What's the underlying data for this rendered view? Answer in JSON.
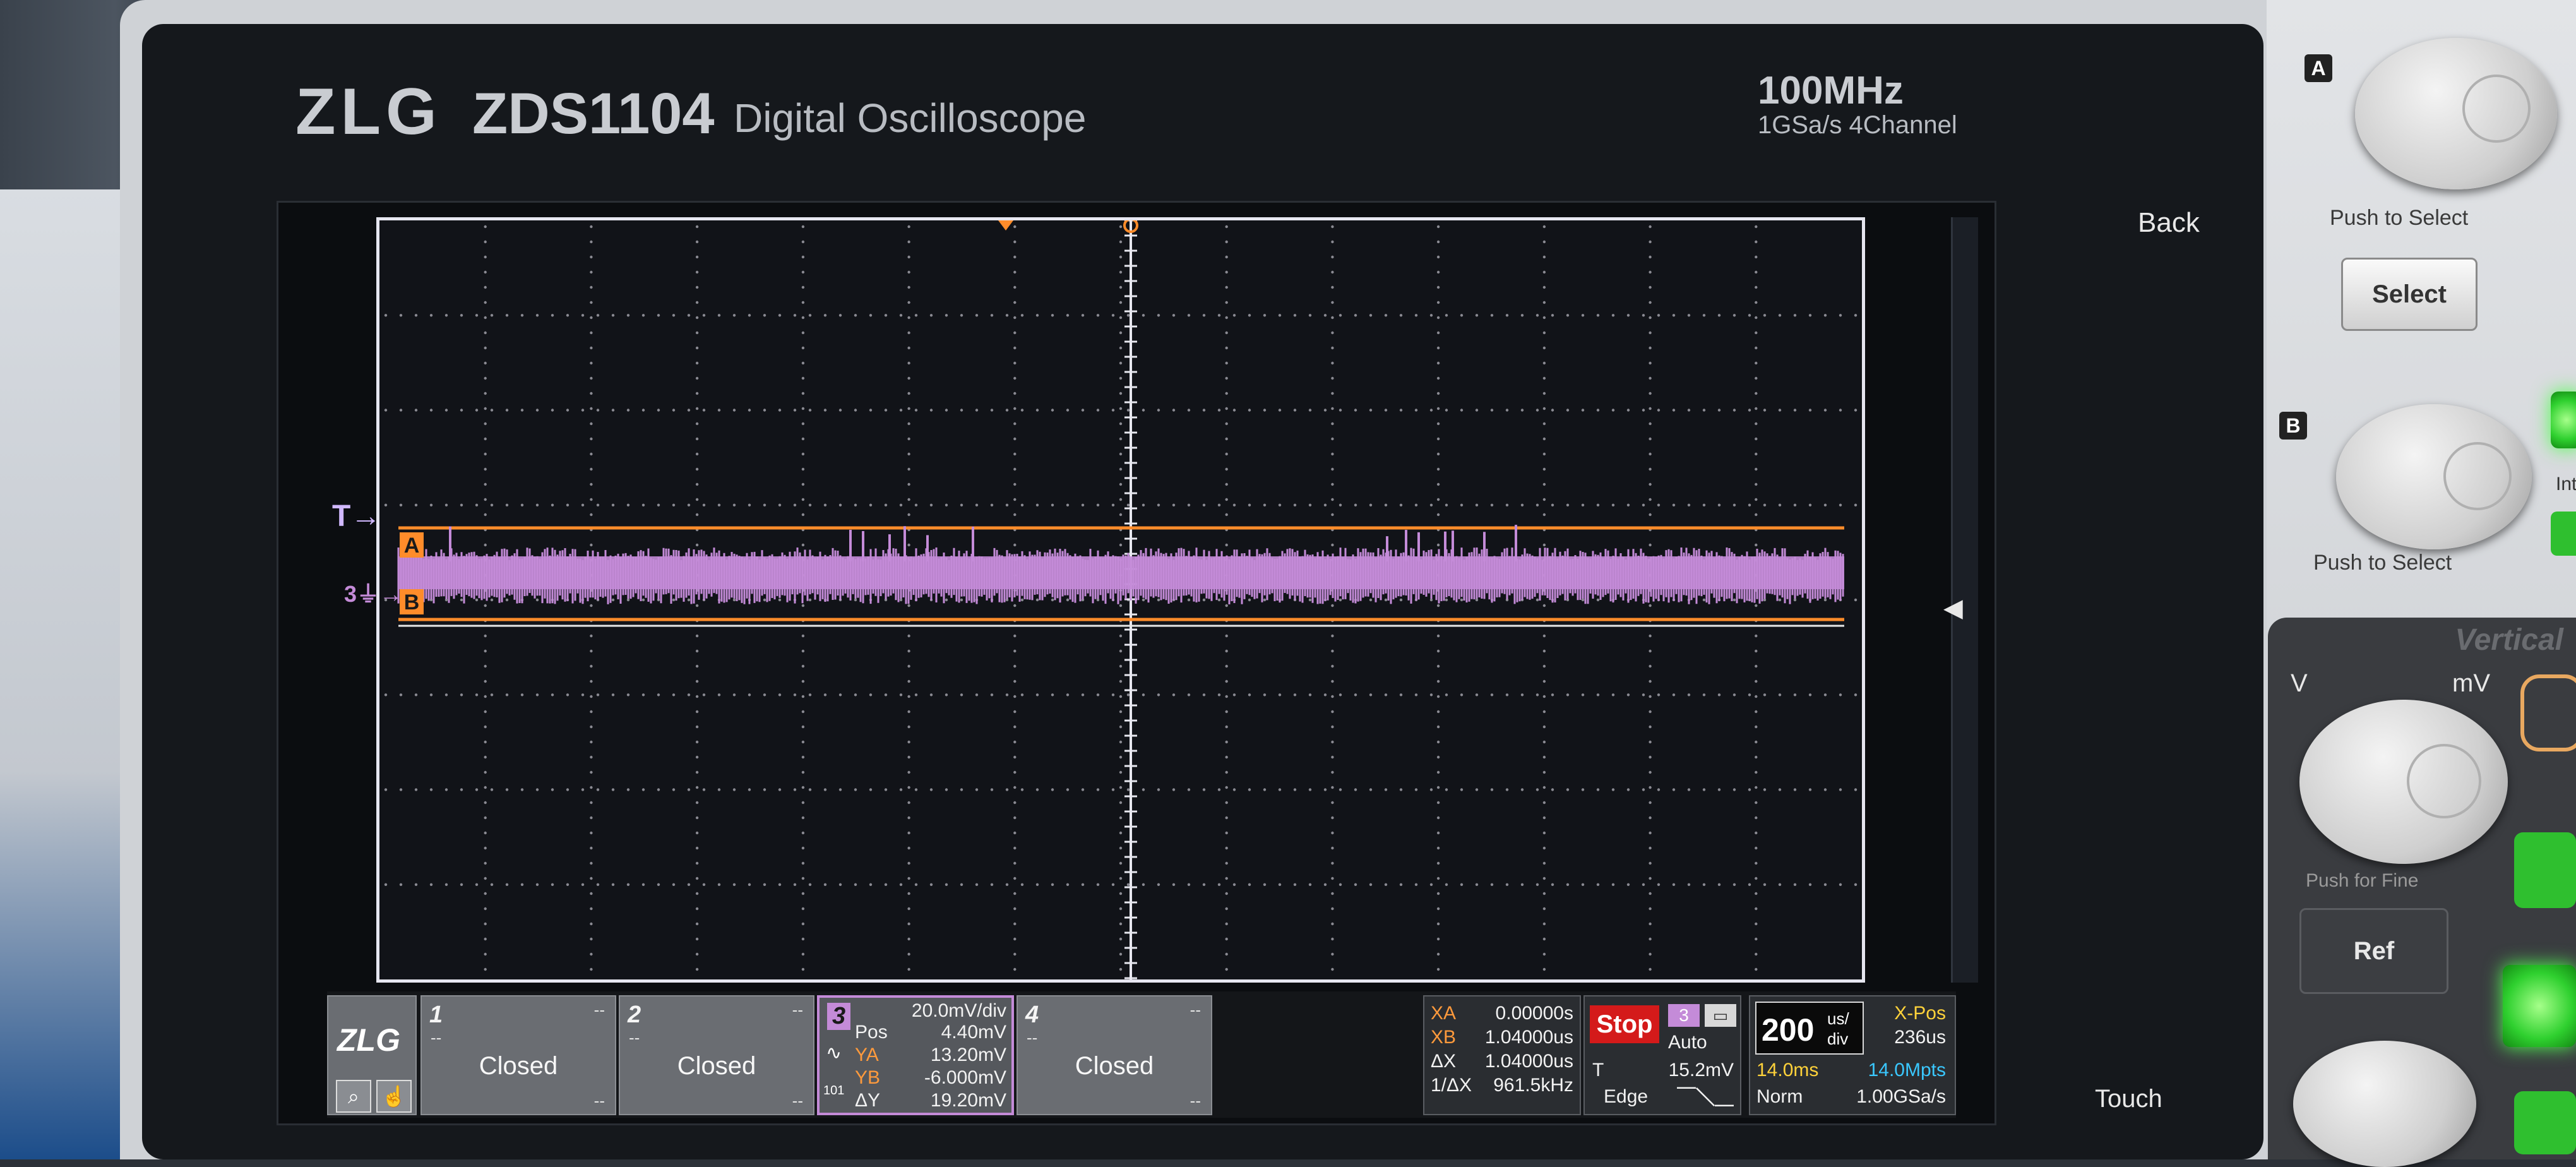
{
  "device": {
    "brand": "ZLG",
    "model": "ZDS1104",
    "subtitle": "Digital Oscilloscope",
    "bandwidth": "100MHz",
    "sample_spec": "1GSa/s 4Channel"
  },
  "markers": {
    "trigger_label": "T",
    "ch3_label": "3",
    "cursor_a_label": "A",
    "cursor_b_label": "B"
  },
  "channels": [
    {
      "number": "1",
      "dash_right": "--",
      "dash_bottom": "--",
      "status": "Closed",
      "coupling": "--"
    },
    {
      "number": "2",
      "dash_right": "--",
      "dash_bottom": "--",
      "status": "Closed",
      "coupling": "--"
    },
    {
      "number": "4",
      "dash_right": "--",
      "dash_bottom": "--",
      "status": "Closed",
      "coupling": "--"
    }
  ],
  "ch3": {
    "number": "3",
    "scale": "20.0mV/div",
    "pos_label": "Pos",
    "pos_value": "4.40mV",
    "ya_label": "YA",
    "ya_value": "13.20mV",
    "yb_label": "YB",
    "yb_value": "-6.000mV",
    "dy_label": "ΔY",
    "dy_value": "19.20mV",
    "impedance": "101"
  },
  "cursors": {
    "xa_label": "XA",
    "xa_value": "0.00000s",
    "xb_label": "XB",
    "xb_value": "1.04000us",
    "dx_label": "ΔX",
    "dx_value": "1.04000us",
    "inv_dx_label": "1/ΔX",
    "inv_dx_value": "961.5kHz"
  },
  "run": {
    "state": "Stop",
    "trigger_channel": "3",
    "trigger_mode": "Auto",
    "trigger_label": "T",
    "trigger_level": "15.2mV",
    "trigger_type": "Edge"
  },
  "timebase": {
    "value": "200",
    "unit_top": "us/",
    "unit_bottom": "div",
    "xpos_label": "X-Pos",
    "xpos_value": "236us",
    "record_time": "14.0ms",
    "memory_depth": "14.0Mpts",
    "acq_mode": "Norm",
    "sample_rate": "1.00GSa/s"
  },
  "softkeys": {
    "back": "Back",
    "touch": "Touch"
  },
  "front_panel": {
    "knob_a_badge": "A",
    "knob_a_label": "Push to Select",
    "select_button": "Select",
    "knob_b_badge": "B",
    "knob_b_label": "Push to Select",
    "vertical_title": "Vertical",
    "v_label": "V",
    "mv_label": "mV",
    "push_fine_label": "Push for Fine",
    "ref_button": "Ref"
  },
  "colors": {
    "ch3_trace": "#c48bd8",
    "cursor_orange": "#ff8c2a",
    "stop_red": "#d41a1a",
    "record_yellow": "#ffd23a",
    "memory_cyan": "#3ac8ff",
    "grid_dots": "#8a8a92"
  }
}
